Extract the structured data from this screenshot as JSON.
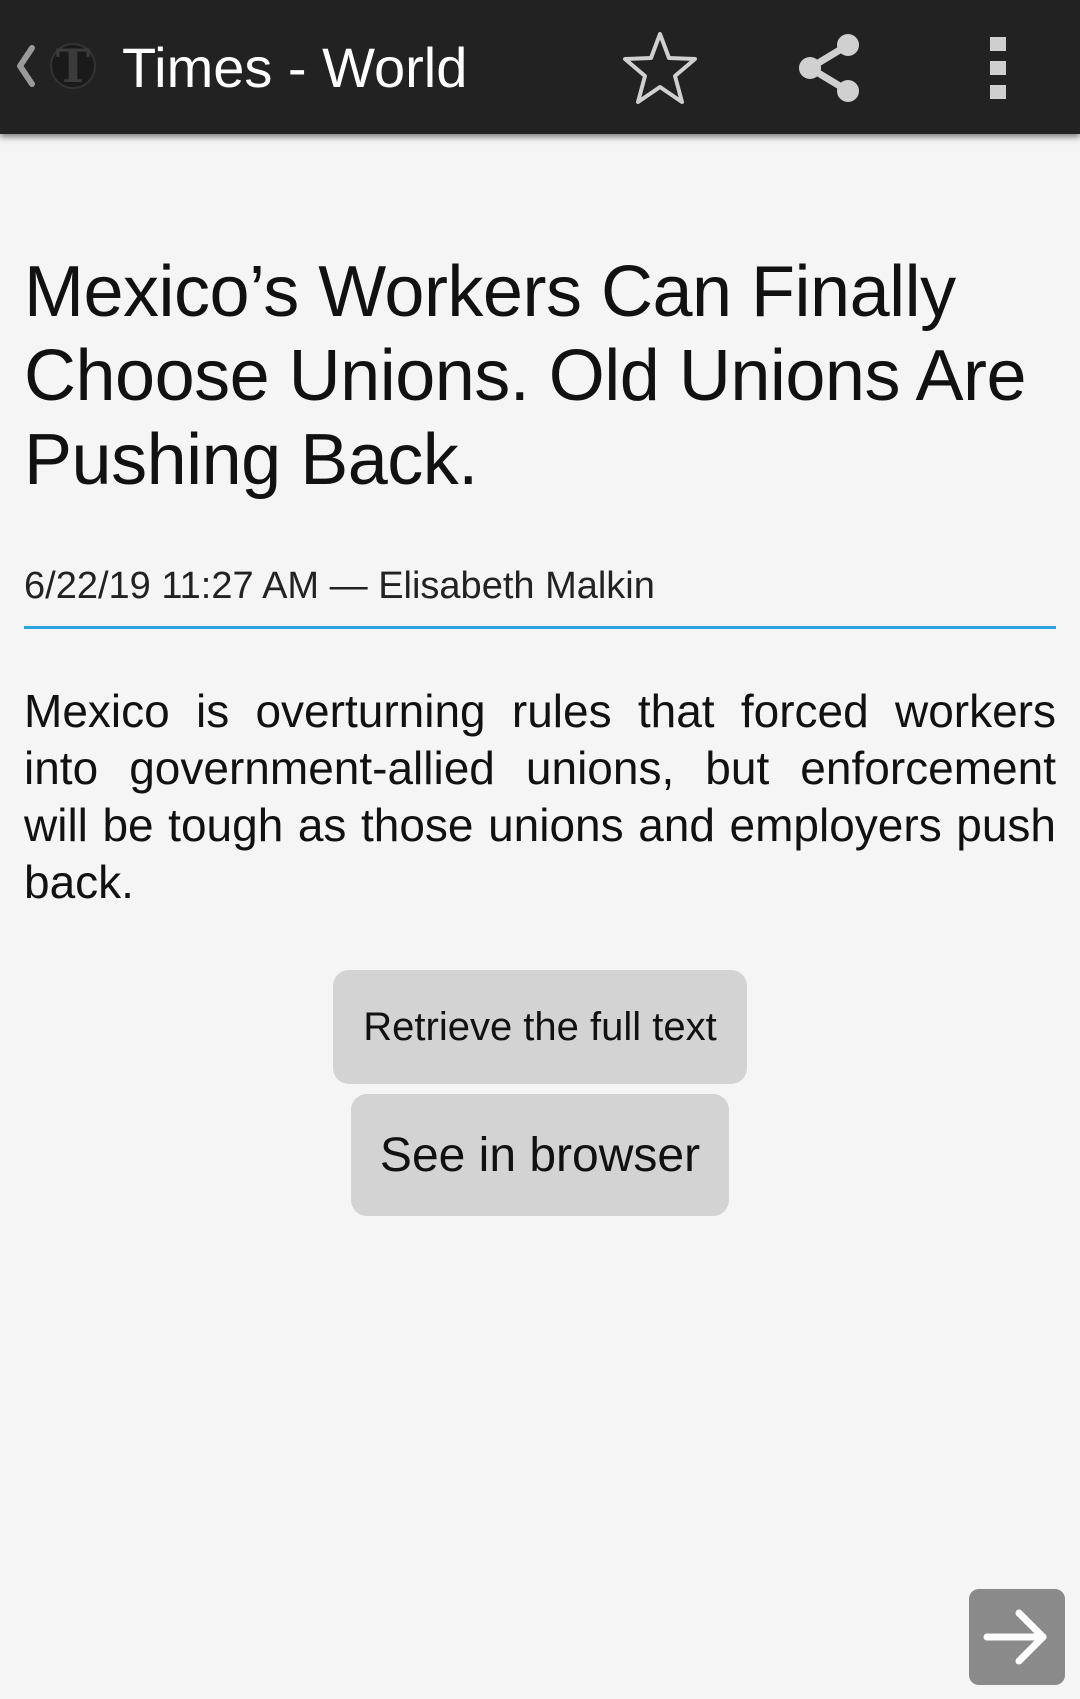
{
  "appbar": {
    "title": "Times - World",
    "icons": {
      "back": "chevron-left-icon",
      "logo": "nyt-logo-icon",
      "favorite": "star-outline-icon",
      "share": "share-icon",
      "menu": "more-vertical-icon"
    },
    "background": "#222222"
  },
  "article": {
    "headline": "Mexico’s Workers Can Finally Choose Unions. Old Unions Are Pushing Back.",
    "meta": "6/22/19 11:27 AM — Elisabeth Malkin",
    "summary": "Mexico is overturning rules that forced workers into government-allied unions, but enforcement will be tough as those unions and employers push back.",
    "divider_color": "#2aa3e0"
  },
  "actions": {
    "retrieve_label": "Retrieve the full text",
    "browser_label": "See in browser"
  },
  "navigation": {
    "next_icon": "arrow-right-icon"
  }
}
